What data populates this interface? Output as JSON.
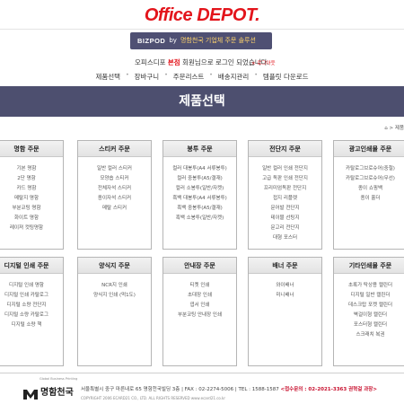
{
  "header": {
    "logo_office": "Office ",
    "logo_depot": "DEPOT.",
    "bizpod": "BIZPOD",
    "by": "by",
    "partner": "명함천국 기업체 주문 솔루션"
  },
  "login": {
    "prefix": "오피스디포 ",
    "highlight": "본점",
    "suffix": " 회원님으로 로그인 되었습니다.",
    "logout": "로그아웃"
  },
  "nav": [
    "제품선택",
    "장바구니",
    "주문리스트",
    "배송지관리",
    "템플릿 다운로드"
  ],
  "banner": {
    "title": "제품선택"
  },
  "breadcrumb": "⌂ > 제품",
  "cards": [
    {
      "title": "명함 주문",
      "items": [
        "기본 명함",
        "2단 명함",
        "카드 명함",
        "메탈지 명함",
        "부분코팅 명함",
        "화이트 명함",
        "레이져 컷팅명함"
      ]
    },
    {
      "title": "스티커 주문",
      "items": [
        "일반 컬러 스티커",
        "모양숍 스티커",
        "전체자석 스티커",
        "종이자석 스티커",
        "메탈 스티커"
      ]
    },
    {
      "title": "봉투 주문",
      "items": [
        "컬러 대봉투(A4 서류봉투)",
        "컬러 중봉투(A5/결재)",
        "컬러 소봉투(일반/자켓)",
        "흑백 대봉투(A4 서류봉투)",
        "흑백 중봉투(A5/결재)",
        "흑백 소봉투(일반/자켓)"
      ]
    },
    {
      "title": "전단지 주문",
      "items": [
        "일반 컬러 인쇄 전단지",
        "고급 독판 인쇄 전단지",
        "프리미엄독판 전단지",
        "접지 리플렛",
        "문어발 전단지",
        "테이블 선팅지",
        "문고리 전단지",
        "대형 포스터"
      ]
    },
    {
      "title": "광고인쇄물 주문",
      "items": [
        "카탈로그브로슈어(중철)",
        "카탈로그브로슈어(무선)",
        "종이 쇼핑백",
        "종이 홀더"
      ]
    },
    {
      "title": "디지털 인쇄 주문",
      "items": [
        "디지털 인쇄 명함",
        "디지털 인쇄 카탈로그",
        "디지털 소량 전단지",
        "디지털 소량 카탈로그",
        "디지털 소량 책"
      ]
    },
    {
      "title": "양식지 주문",
      "items": [
        "NCR지 인쇄",
        "양식지 인쇄 (먹1도)"
      ]
    },
    {
      "title": "안내장 주문",
      "items": [
        "티켓 인쇄",
        "초대장 인쇄",
        "엽서 인쇄",
        "부분코팅 안내장 인쇄"
      ]
    },
    {
      "title": "배너 주문",
      "items": [
        "와이배너",
        "미니배너"
      ]
    },
    {
      "title": "기타인쇄물 주문",
      "items": [
        "초록가 탁상용 캘린더",
        "디지털 일반 캘린더",
        "데스크탑 포켓 캘린더",
        "벽걸이형 캘린더",
        "포스터형 캘린더",
        "스크래치 복권"
      ]
    }
  ],
  "footer": {
    "brand": "명함천국",
    "brand_sub": "Global Business Printing",
    "address": "서울특별시 중구 마른내로 65 명함천국빌딩 3층 | FAX : 02-2274-5006 | TEL : 1588-1587 ",
    "inquiry": "<접수문의 : 02-2021-3363 권혁걸 과장>",
    "copyright": "COPYRIGHT 2006 ECARD21 CO., LTD. ALL RIGHTS RESERVED    www.ecard21.co.kr"
  },
  "colors": {
    "brand_red": "#e3141b",
    "banner": "#4d4f6f",
    "bizpod_bar": "#4f5073"
  }
}
